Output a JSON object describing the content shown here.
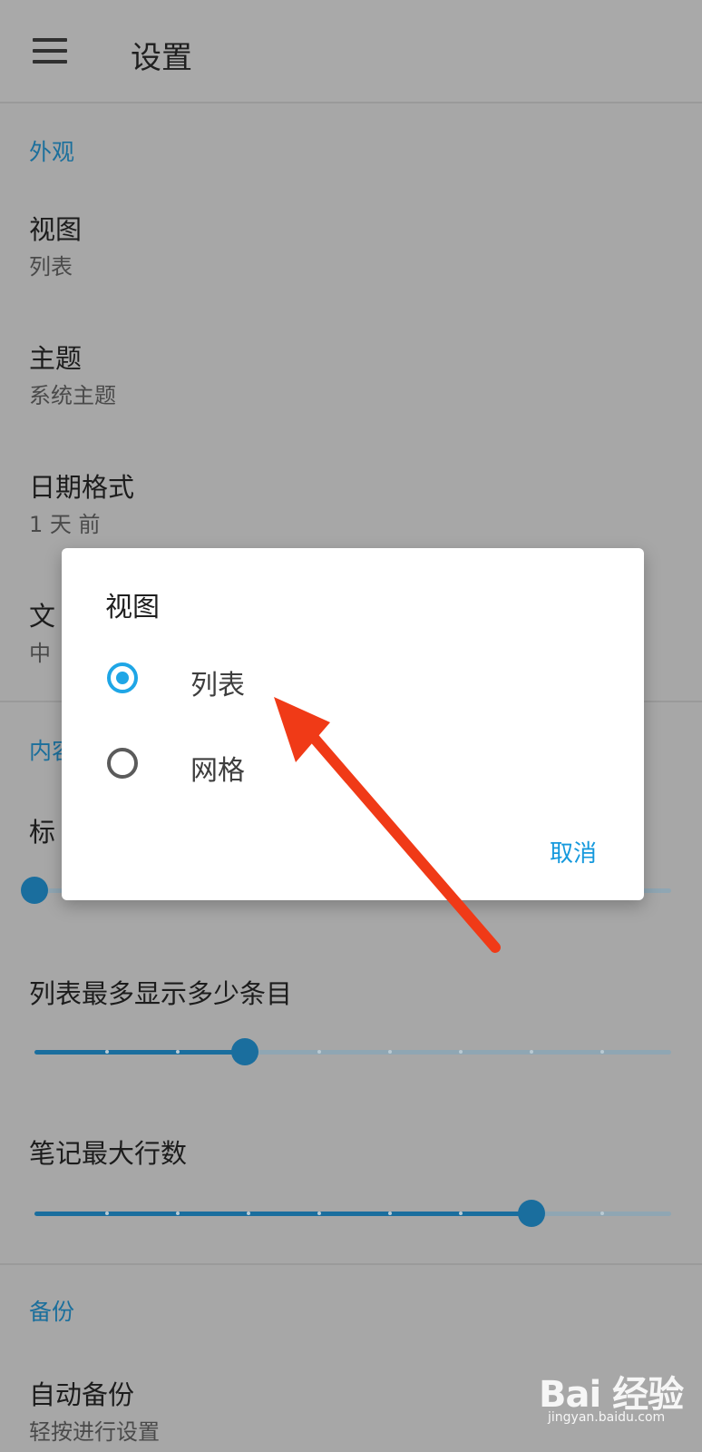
{
  "appbar": {
    "title": "设置",
    "menu_icon": "hamburger-menu-icon"
  },
  "sections": {
    "appearance": {
      "header": "外观",
      "items": [
        {
          "title": "视图",
          "value": "列表"
        },
        {
          "title": "主题",
          "value": "系统主题"
        },
        {
          "title": "日期格式",
          "value": "1 天 前"
        },
        {
          "title": "文",
          "value": "中"
        }
      ]
    },
    "content": {
      "header": "内容",
      "title_fragment": "标",
      "slider_value_fraction": 0.0,
      "max_items_title": "列表最多显示多少条目",
      "max_items_fraction": 0.33,
      "max_lines_title": "笔记最大行数",
      "max_lines_fraction": 0.78
    },
    "backup": {
      "header": "备份",
      "auto_backup_title": "自动备份",
      "auto_backup_sub": "轻按进行设置"
    }
  },
  "dialog": {
    "title": "视图",
    "options": [
      {
        "label": "列表",
        "selected": true
      },
      {
        "label": "网格",
        "selected": false
      }
    ],
    "cancel": "取消"
  },
  "colors": {
    "accent": "#1fa6e6",
    "section": "#1b6f9c",
    "arrow": "#f03a17"
  },
  "watermark": {
    "text": "Bai 经验",
    "sub": "jingyan.baidu.com"
  }
}
